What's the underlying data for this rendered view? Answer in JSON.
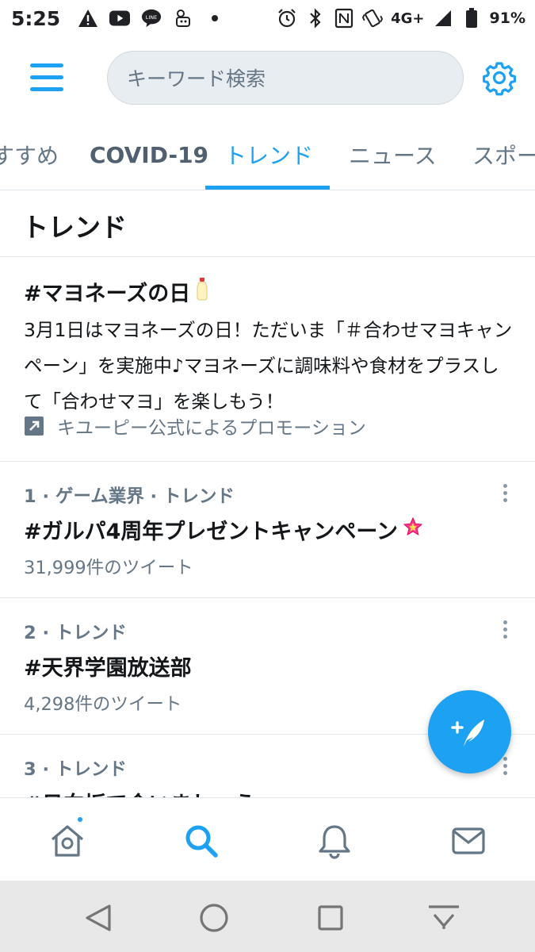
{
  "status_bar": {
    "time": "5:25",
    "network": "4G+",
    "battery": "91%",
    "icons": [
      "warning-icon",
      "youtube-icon",
      "line-icon",
      "tamagotchi-icon",
      "dot-icon",
      "alarm-icon",
      "bluetooth-icon",
      "nfc-icon",
      "vibrate-icon",
      "signal-icon",
      "battery-icon"
    ]
  },
  "header": {
    "menu_icon": "hamburger-menu-icon",
    "search_placeholder": "キーワード検索",
    "settings_icon": "gear-icon"
  },
  "tabs": [
    {
      "label": "すすめ",
      "active": false
    },
    {
      "label": "COVID-19",
      "active": false
    },
    {
      "label": "トレンド",
      "active": true
    },
    {
      "label": "ニュース",
      "active": false
    },
    {
      "label": "スポー",
      "active": false
    }
  ],
  "section_title": "トレンド",
  "promoted": {
    "title": "#マヨネーズの日",
    "title_emoji": "mayonnaise-icon",
    "description": "3月1日はマヨネーズの日！ただいま「＃合わせマヨキャンペーン」を実施中♪マヨネーズに調味料や食材をプラスして「合わせマヨ」を楽しもう！",
    "promoted_by": "キユーピー公式によるプロモーション"
  },
  "trends": [
    {
      "meta": "1 · ゲーム業界 · トレンド",
      "name": "#ガルパ4周年プレゼントキャンペーン",
      "count": "31,999件のツイート",
      "emoji": "star-icon"
    },
    {
      "meta": "2 · トレンド",
      "name": "#天界学園放送部",
      "count": "4,298件のツイート"
    },
    {
      "meta": "3 · トレンド",
      "name": "#日向坂で会いましょう",
      "count": ""
    }
  ],
  "colors": {
    "accent": "#1da1f2",
    "text_primary": "#14171a",
    "text_secondary": "#657786",
    "divider": "#e1e8ed"
  },
  "bottom_nav": [
    "home-icon",
    "search-icon",
    "notifications-icon",
    "messages-icon"
  ],
  "system_nav": [
    "back-icon",
    "home-circle-icon",
    "recents-icon",
    "notification-pull-icon"
  ]
}
